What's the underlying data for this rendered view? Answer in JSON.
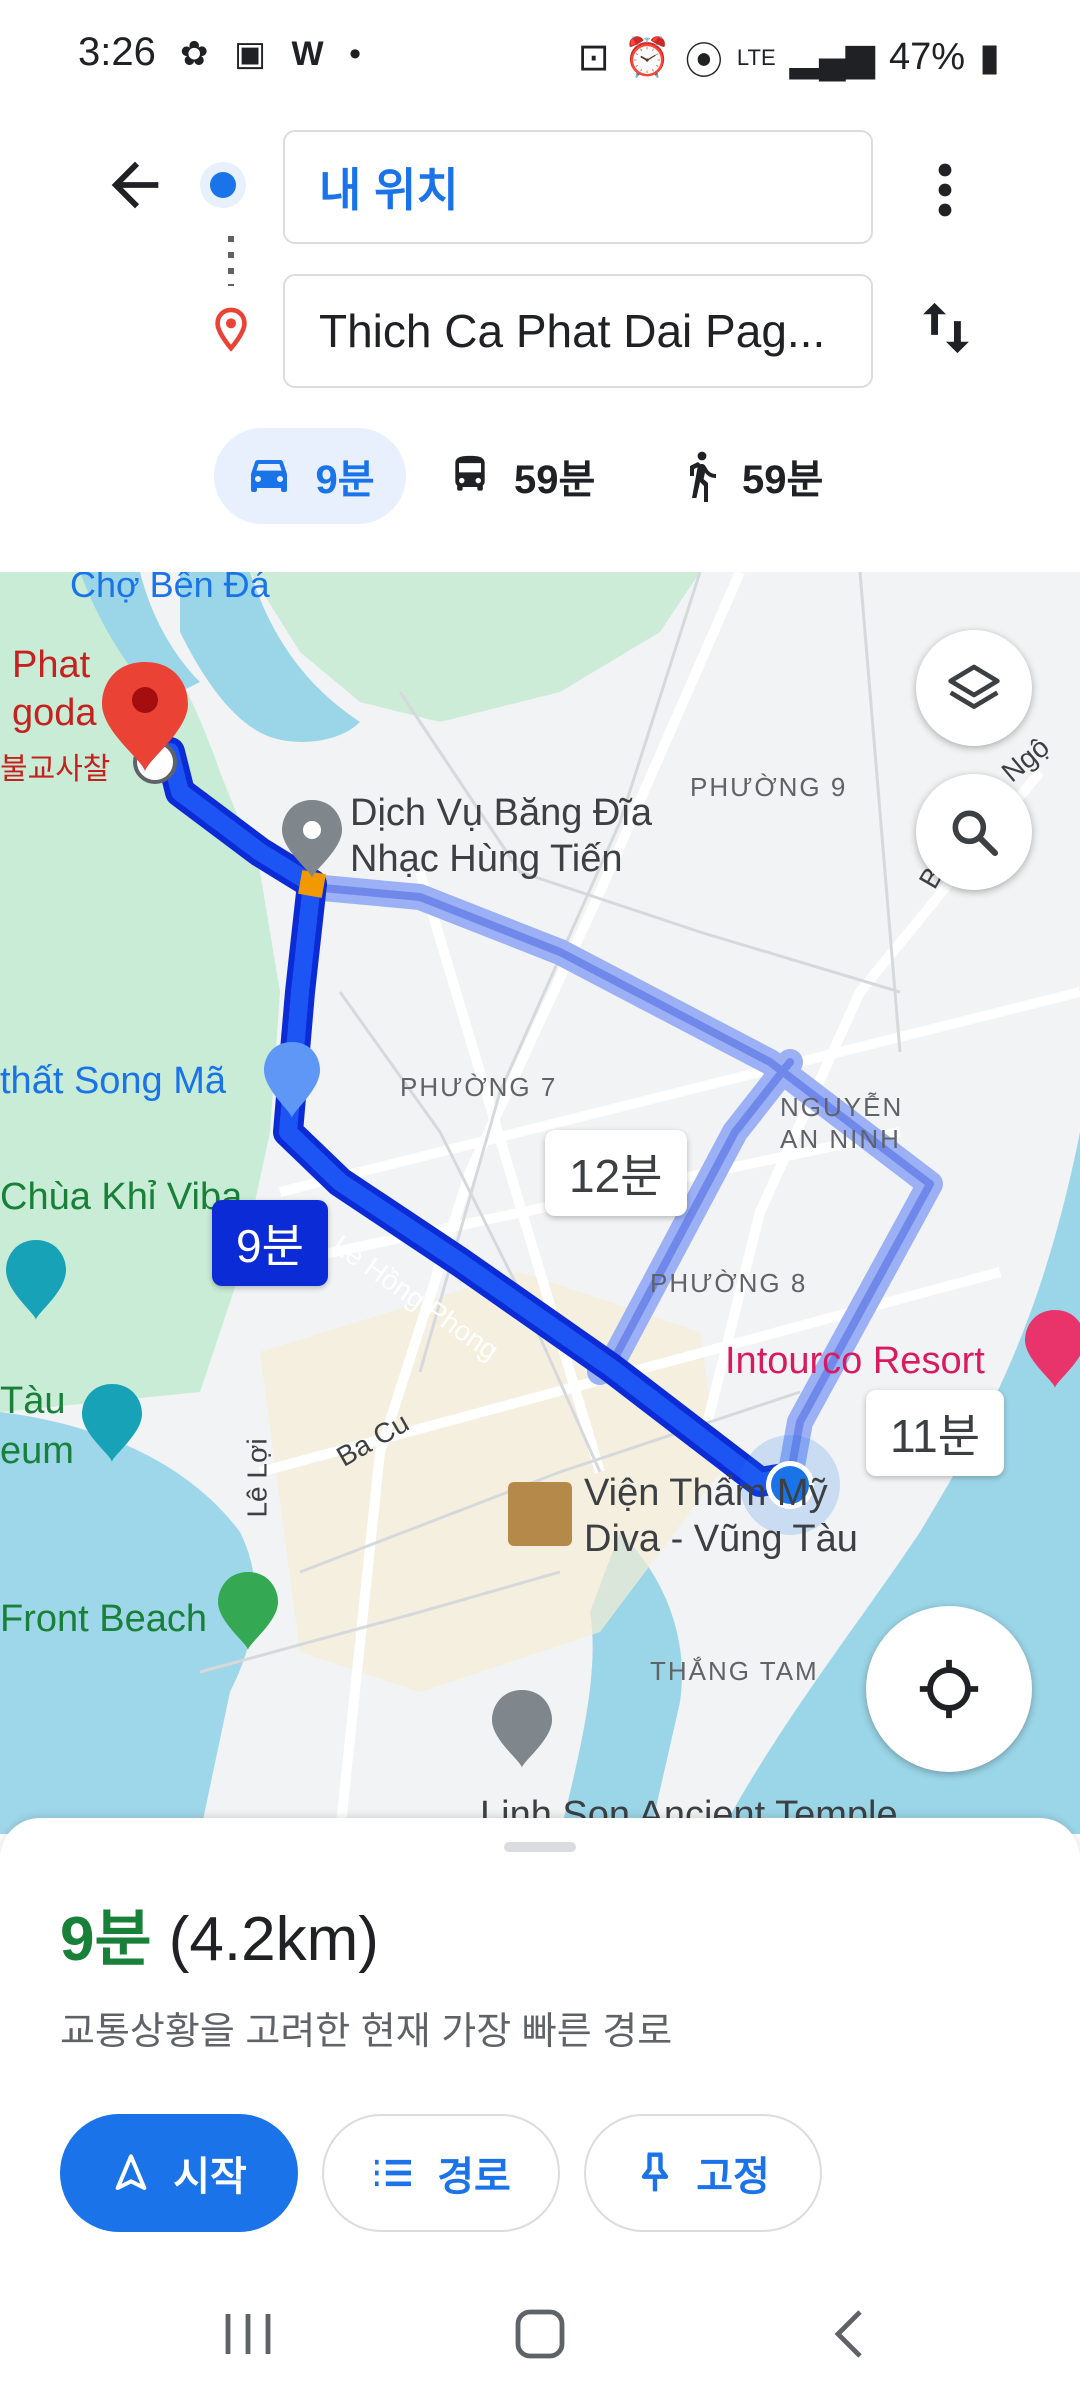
{
  "status_bar": {
    "time": "3:26",
    "network": "LTE",
    "battery": "47%"
  },
  "header": {
    "origin": "내 위치",
    "destination": "Thich Ca Phat Dai Pag..."
  },
  "modes": [
    {
      "name": "car",
      "label": "9분",
      "selected": true
    },
    {
      "name": "transit",
      "label": "59분",
      "selected": false
    },
    {
      "name": "walk",
      "label": "59분",
      "selected": false
    }
  ],
  "map": {
    "labels": {
      "cho_ben_da": "Chợ Bến Đá",
      "phat": "Phat",
      "pagoda": "goda",
      "pagoda_ko": "불교사찰",
      "dich_vu1": "Dịch Vụ Băng Đĩa",
      "dich_vu2": "Nhạc Hùng Tiến",
      "phuong9": "PHƯỜNG 9",
      "ngo": "Ngộ",
      "b": "B",
      "that_song_ma": "thất Song Mã",
      "phuong7": "PHƯỜNG 7",
      "nguyen1": "NGUYỄN",
      "nguyen2": "AN NINH",
      "chua_khi": "Chùa Khỉ Viba",
      "le_hong_phong": "Lê Hồng Phong",
      "phuong8": "PHƯỜNG 8",
      "intourco": "Intourco Resort",
      "tau": "Tàu",
      "eum": "eum",
      "le_loi": "Lê Lợi",
      "ba_cu": "Ba Cu",
      "vien1": "Viện Thẩm Mỹ",
      "vien2": "Diva - Vũng Tàu",
      "front_beach": "Front Beach",
      "thang_tam": "THẮNG TAM",
      "linh_son": "Linh Son Ancient Temple"
    },
    "route_bubbles": {
      "main": "9분",
      "alt1": "12분",
      "alt2": "11분"
    }
  },
  "sheet": {
    "time": "9분",
    "distance": "(4.2km)",
    "note": "교통상황을 고려한 현재 가장 빠른 경로",
    "start_label": "시작",
    "steps_label": "경로",
    "pin_label": "고정"
  },
  "colors": {
    "accent": "#1a73e8",
    "route": "#0d40f2",
    "alt_route": "#8ca3f0",
    "eta_green": "#188038",
    "pin_red": "#ea4335"
  }
}
